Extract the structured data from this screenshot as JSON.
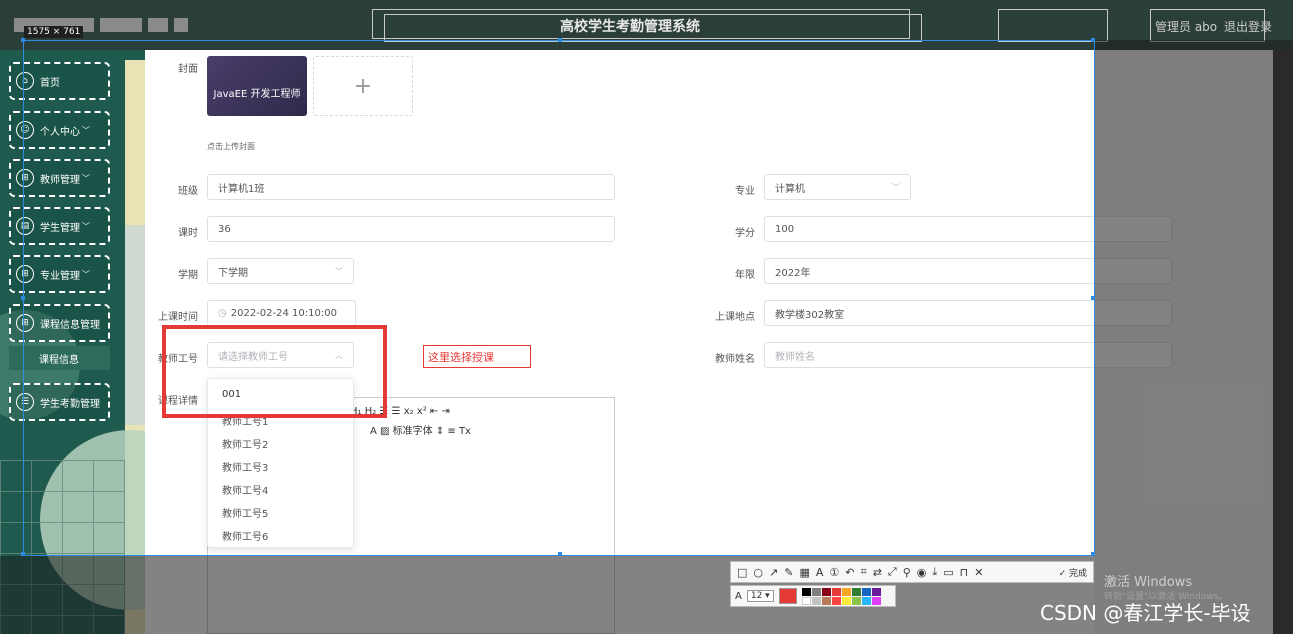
{
  "screen": {
    "dimension_tag": "1575 × 761",
    "app_title": "高校学生考勤管理系统",
    "user_label": "管理员 abo",
    "logout_label": "退出登录"
  },
  "sidebar": {
    "items": [
      {
        "label": "首页",
        "icon": "home-icon"
      },
      {
        "label": "个人中心",
        "icon": "user-icon"
      },
      {
        "label": "教师管理",
        "icon": "grid-icon"
      },
      {
        "label": "学生管理",
        "icon": "clipboard-icon"
      },
      {
        "label": "专业管理",
        "icon": "grid-icon"
      },
      {
        "label": "课程信息管理",
        "icon": "grid-icon"
      }
    ],
    "sub_item": "课程信息",
    "last_item": {
      "label": "学生考勤管理",
      "icon": "list-icon"
    }
  },
  "form": {
    "cover_label": "封面",
    "cover_image_text": "JavaEE 开发工程师",
    "cover_hint": "点击上传封面",
    "class_label": "班级",
    "class_value": "计算机1班",
    "major_label": "专业",
    "major_value": "计算机",
    "hours_label": "课时",
    "hours_value": "36",
    "credit_label": "学分",
    "credit_value": "100",
    "term_label": "学期",
    "term_value": "下学期",
    "year_label": "年限",
    "year_value": "2022年",
    "time_label": "上课时间",
    "time_value": "2022-02-24 10:10:00",
    "place_label": "上课地点",
    "place_value": "教学楼302教室",
    "teacher_id_label": "教师工号",
    "teacher_id_placeholder": "请选择教师工号",
    "teacher_name_label": "教师姓名",
    "teacher_name_placeholder": "教师姓名",
    "detail_label": "课程详情"
  },
  "dropdown": {
    "options": [
      "001",
      "教师工号1",
      "教师工号2",
      "教师工号3",
      "教师工号4",
      "教师工号5",
      "教师工号6"
    ]
  },
  "editor": {
    "row1": "H₁ H₂   ☰  ☰    x₂  x²    ⇤  ⇥",
    "row2": "A  ▨    标准字体    ⇕    ≡    Tx"
  },
  "annotation": {
    "text": "这里选择授课"
  },
  "screenshot_tool": {
    "done_label": "✓ 完成",
    "font_size": "12"
  },
  "watermark": {
    "line1": "激活 Windows",
    "line2": "转到\"设置\"以激活 Windows。",
    "csdn": "CSDN @春江学长-毕设"
  },
  "colors": {
    "sidebar_bg": "#1e5b4e",
    "highlight_red": "#e53935",
    "selection_blue": "#2e8ce0"
  }
}
